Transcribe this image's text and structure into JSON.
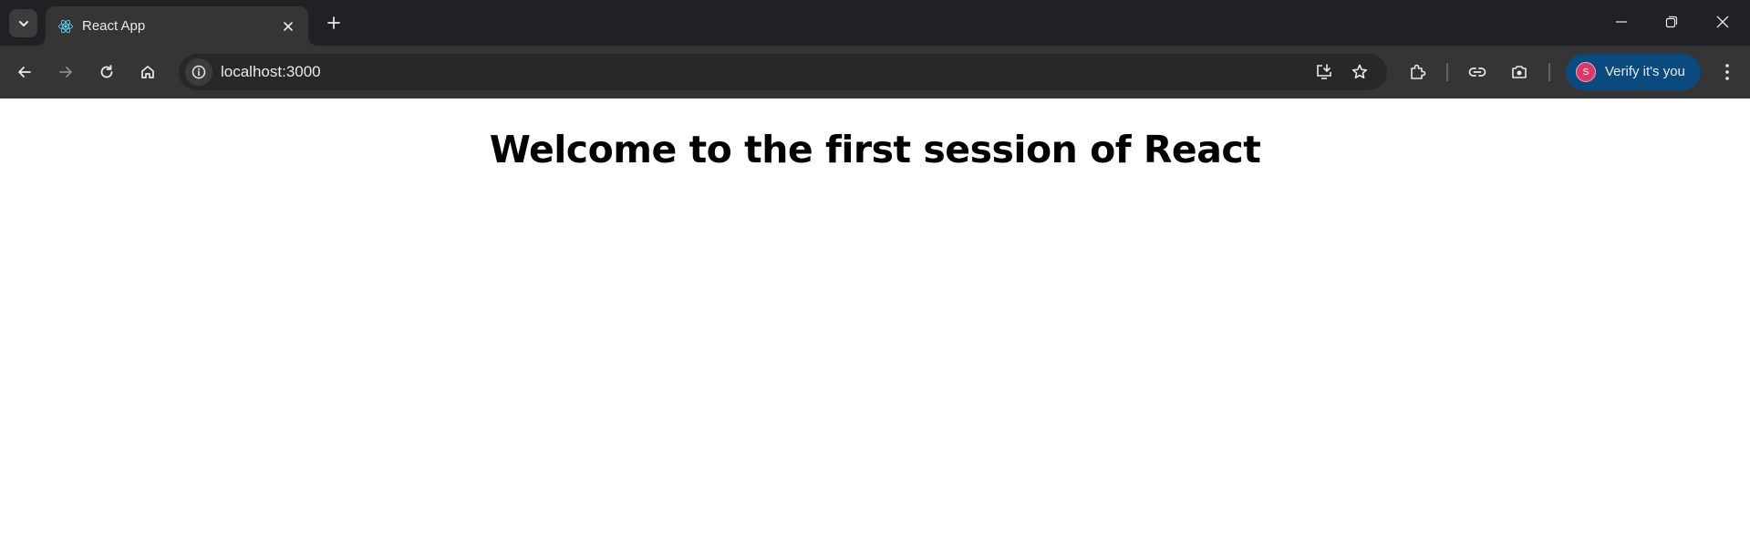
{
  "browser": {
    "tab": {
      "title": "React App",
      "favicon": "react-logo-icon"
    },
    "address_bar": {
      "url": "localhost:3000"
    },
    "profile": {
      "initial": "S",
      "label": "Verify it's you"
    },
    "colors": {
      "tabstrip": "#202124",
      "toolbar": "#353535",
      "omnibox": "#282828",
      "verify_button": "#0b4a7e",
      "react_logo": "#61dafb"
    }
  },
  "page": {
    "heading": "Welcome to the first session of React"
  }
}
